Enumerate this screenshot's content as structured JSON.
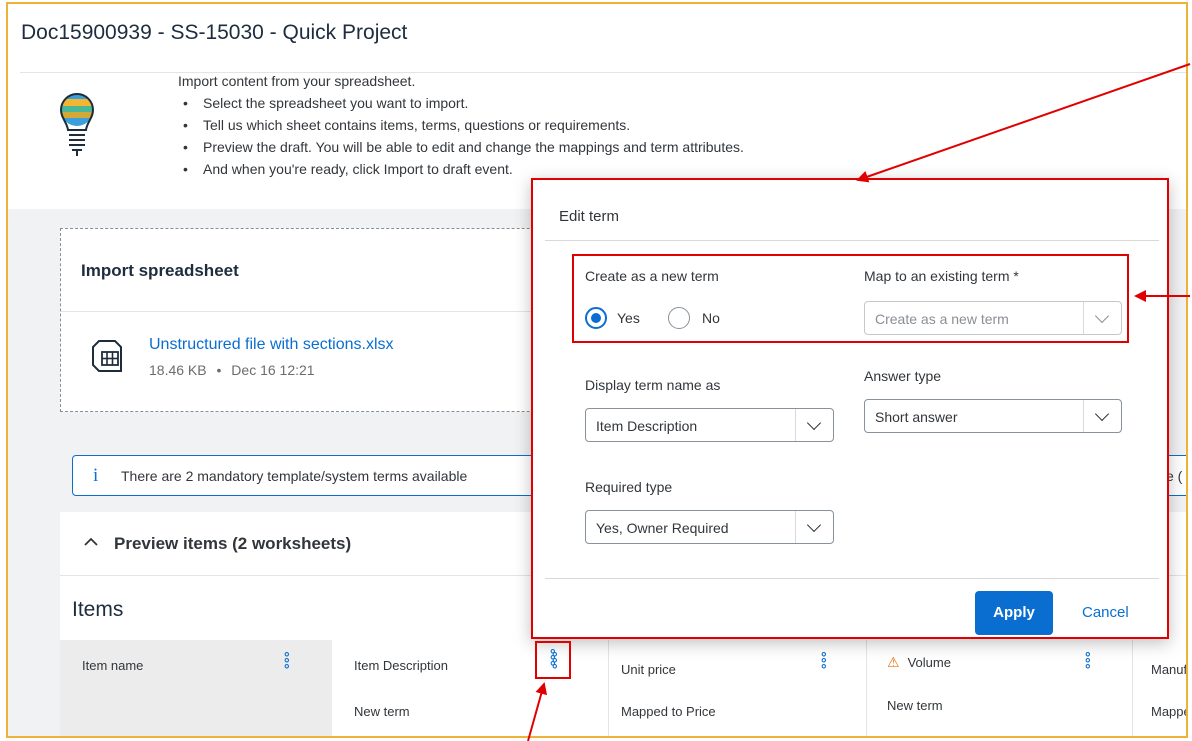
{
  "page": {
    "title": "Doc15900939 - SS-15030 - Quick Project"
  },
  "intro": {
    "first_line": "Import content from your spreadsheet.",
    "bullets": [
      "Select the spreadsheet you want to import.",
      "Tell us which sheet contains items, terms, questions or requirements.",
      "Preview the draft. You will be able to edit and change the mappings and term attributes.",
      "And when you're ready, click Import to draft event."
    ]
  },
  "import_card": {
    "title": "Import spreadsheet",
    "file_name": "Unstructured file with sections.xlsx",
    "file_size": "18.46 KB",
    "file_sep": "•",
    "file_date": "Dec 16 12:21"
  },
  "info_bar": {
    "icon": "i",
    "text": "There are 2 mandatory template/system terms available",
    "tail": "e ("
  },
  "preview": {
    "chevron": "^",
    "title": "Preview items (2 worksheets)",
    "items_title": "Items"
  },
  "columns": [
    {
      "header": "Item name",
      "sub": "",
      "icon": ""
    },
    {
      "header": "Item Description",
      "sub": "New term",
      "icon": ""
    },
    {
      "header": "Unit price",
      "sub": "Mapped to Price",
      "icon": ""
    },
    {
      "header": "Volume",
      "sub": "New term",
      "icon": "warning-icon"
    },
    {
      "header": "Manufa",
      "sub": "Mappe",
      "icon": ""
    }
  ],
  "dialog": {
    "title": "Edit term",
    "create_new_label": "Create as a new term",
    "yes_label": "Yes",
    "no_label": "No",
    "map_existing_label": "Map to an existing term *",
    "map_existing_value": "Create as a new term",
    "display_name_label": "Display term name as",
    "display_name_value": "Item Description",
    "answer_type_label": "Answer type",
    "answer_type_value": "Short answer",
    "required_type_label": "Required type",
    "required_type_value": "Yes, Owner Required",
    "apply_label": "Apply",
    "cancel_label": "Cancel"
  },
  "colors": {
    "accent": "#0a6ed1",
    "highlight": "#e00000",
    "frame": "#f0b13a",
    "warning": "#e9730c"
  }
}
